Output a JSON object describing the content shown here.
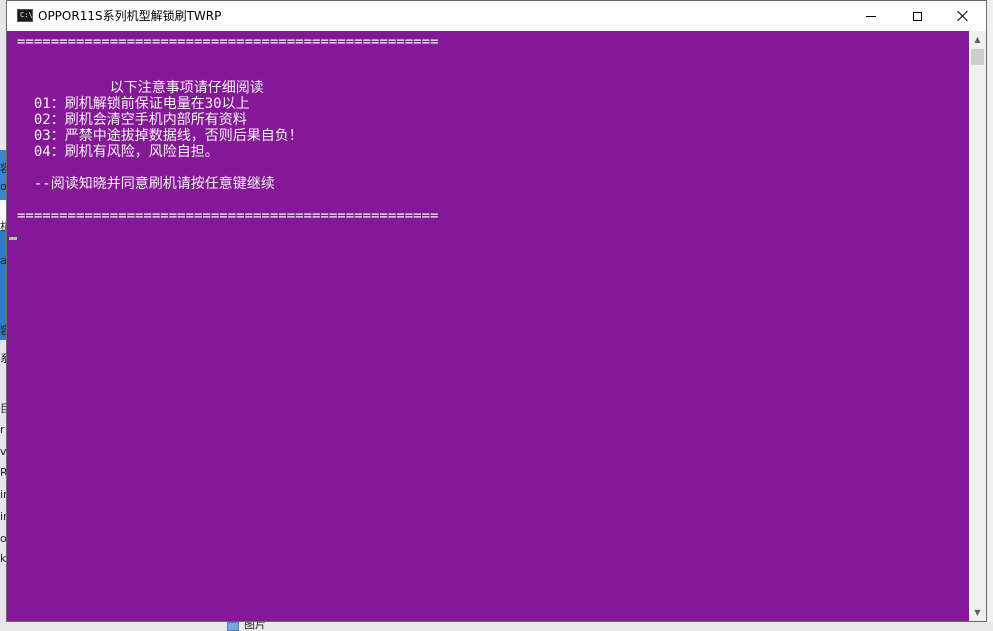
{
  "window": {
    "title": "OPPOR11S系列机型解锁刷TWRP",
    "icon_text": "C:\\"
  },
  "console": {
    "lines": [
      "==================================================",
      "",
      "",
      "",
      "           以下注意事项请仔细阅读",
      "  01：刷机解锁前保证电量在30以上",
      "  02：刷机会清空手机内部所有资料",
      "  03：严禁中途拔掉数据线，否则后果自负！",
      "  04：刷机有风险，风险自担。",
      "",
      "  --阅读知晓并同意刷机请按任意键继续",
      "",
      "=================================================="
    ],
    "background_color": "#851896",
    "text_color": "#f4f4f4",
    "cursor_color": "#7be37b"
  },
  "scrollbar": {
    "up_icon": "scroll-up-arrow-icon",
    "down_icon": "scroll-down-arrow-icon"
  },
  "background": {
    "left_glyphs": [
      "容",
      "o",
      "机",
      "a",
      "容",
      "系",
      "目",
      "r",
      "vb",
      "R",
      "ir",
      "ir",
      "o",
      "ke"
    ],
    "folder_label": "图片"
  }
}
